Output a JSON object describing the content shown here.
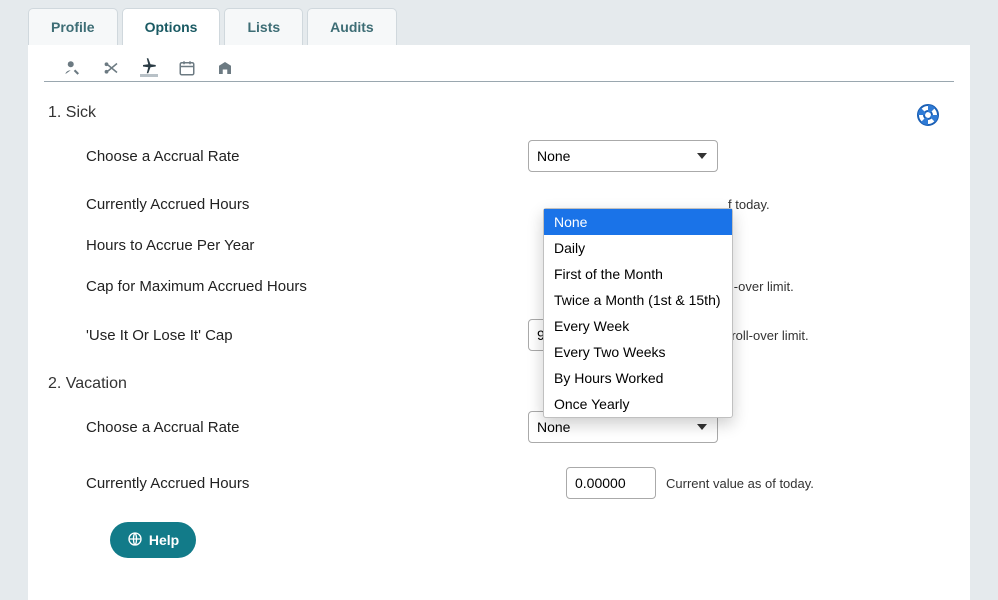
{
  "tabs": {
    "profile": "Profile",
    "options": "Options",
    "lists": "Lists",
    "audits": "Audits"
  },
  "sections": [
    {
      "number": "1.",
      "title": "Sick",
      "rows": {
        "accrual_rate_label": "Choose a Accrual Rate",
        "accrual_rate_value": "None",
        "accrued_hours_label": "Currently Accrued Hours",
        "accrued_hours_hint_partial": "f today.",
        "hours_per_year_label": "Hours to Accrue Per Year",
        "max_cap_label": "Cap for Maximum Accrued Hours",
        "max_cap_hint_partial": "ll-over limit.",
        "use_lose_label": "'Use It Or Lose It' Cap",
        "use_lose_value": "99999.000",
        "use_lose_hint": "Use 99999 for no roll-over limit."
      }
    },
    {
      "number": "2.",
      "title": "Vacation",
      "rows": {
        "accrual_rate_label": "Choose a Accrual Rate",
        "accrual_rate_value": "None",
        "accrued_hours_label": "Currently Accrued Hours",
        "accrued_hours_value": "0.00000",
        "accrued_hours_hint": "Current value as of today."
      }
    }
  ],
  "dropdown_options": [
    "None",
    "Daily",
    "First of the Month",
    "Twice a Month (1st & 15th)",
    "Every Week",
    "Every Two Weeks",
    "By Hours Worked",
    "Once Yearly"
  ],
  "help_label": "Help"
}
